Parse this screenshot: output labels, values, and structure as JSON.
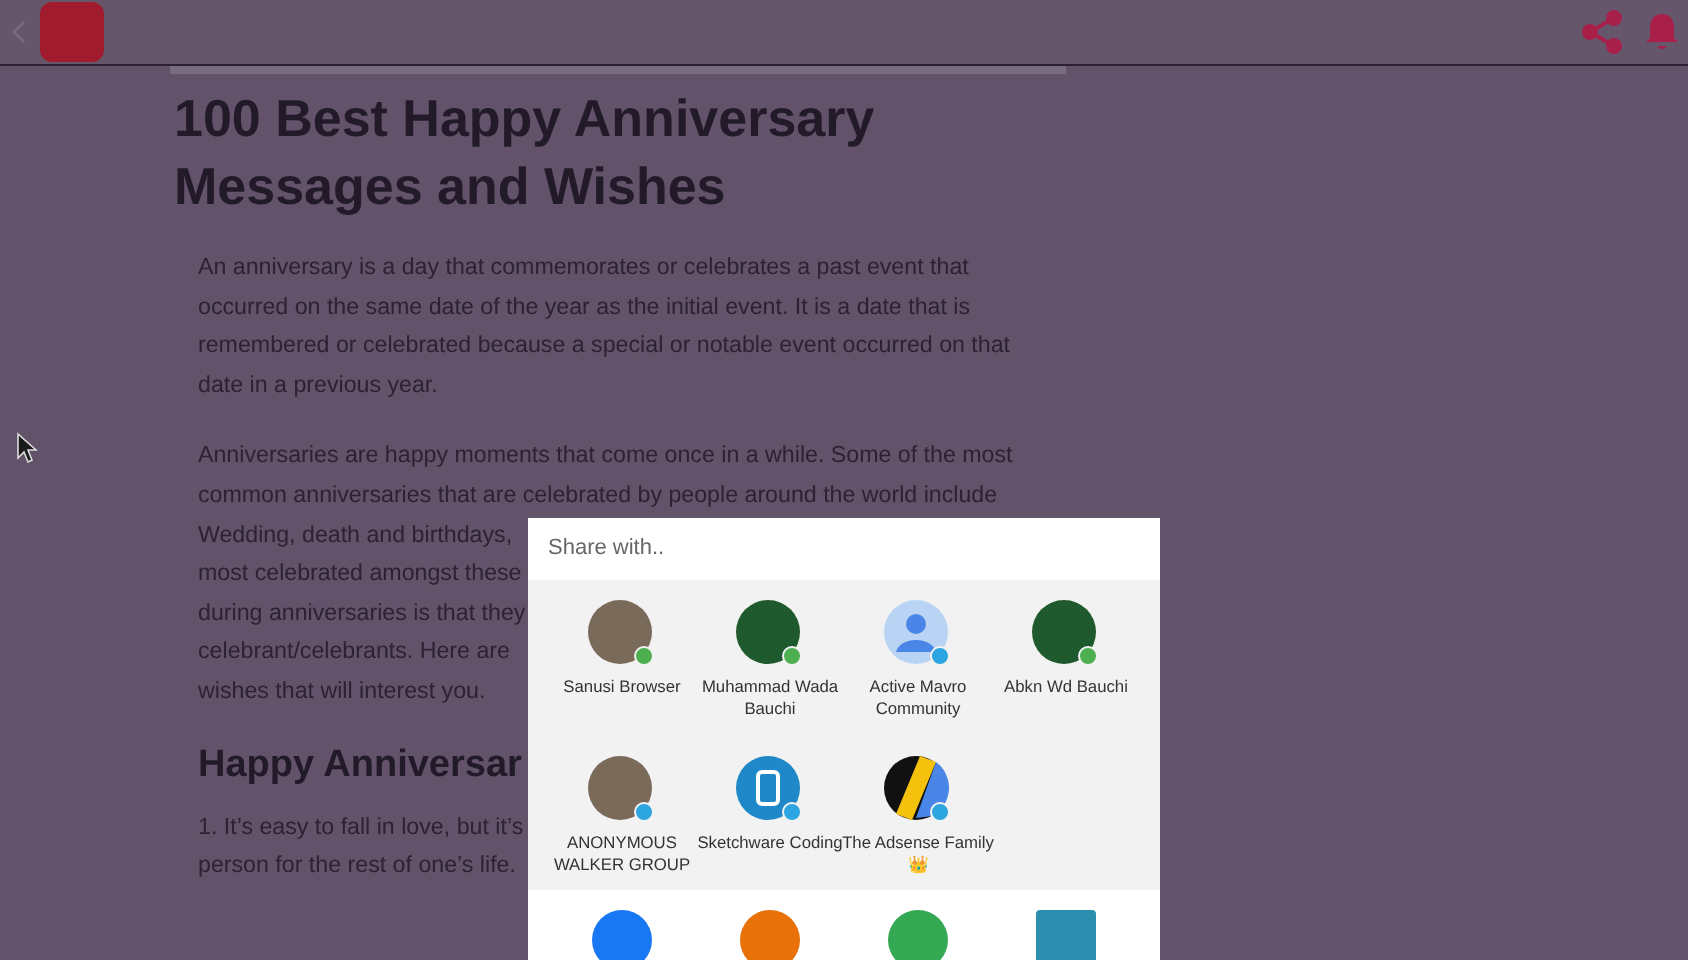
{
  "article": {
    "title_lines": [
      "100 Best Happy Anniversary",
      "Messages and Wishes"
    ],
    "paragraphs": [
      [
        "An anniversary is a day that commemorates or celebrates a past event that",
        "occurred on the same date of the year as the initial event. It is a date that is",
        "remembered or celebrated because a special or notable event occurred on that",
        "date in a previous year."
      ],
      [
        "Anniversaries are happy moments that come once in a while. Some of the most",
        "common anniversaries that are celebrated by people around the world include",
        "Wedding, death and birthdays,",
        "most celebrated amongst these",
        "during anniversaries is that they",
        "celebrant/celebrants. Here are",
        "wishes that will interest you."
      ]
    ],
    "heading": "Happy Anniversar",
    "list_lines": [
      "1. It’s easy to fall in love, but it’s",
      "person for the rest of one’s life."
    ]
  },
  "share_dialog": {
    "title": "Share with..",
    "targets": [
      {
        "label": "Sanusi Browser",
        "kind": "photo",
        "color": "#4caf50"
      },
      {
        "label": "Muhammad Wada Bauchi",
        "kind": "photo",
        "color": "#4caf50"
      },
      {
        "label": "Active Mavro Community",
        "kind": "person",
        "color": "#2ca5e0"
      },
      {
        "label": "Abkn Wd Bauchi",
        "kind": "photo",
        "color": "#4caf50"
      },
      {
        "label": "ANONYMOUS WALKER GROUP",
        "kind": "photo",
        "color": "#2ca5e0"
      },
      {
        "label": "Sketchware Coding",
        "kind": "logo",
        "color": "#2ca5e0"
      },
      {
        "label": "The Adsense Family 👑",
        "kind": "stripes",
        "color": "#2ca5e0"
      }
    ],
    "apps": [
      {
        "kind": "circle",
        "color": "#1877f2"
      },
      {
        "kind": "circle",
        "color": "#e8710a"
      },
      {
        "kind": "circle",
        "color": "#34a853"
      },
      {
        "kind": "square",
        "color": "#2d8fb0"
      }
    ]
  }
}
